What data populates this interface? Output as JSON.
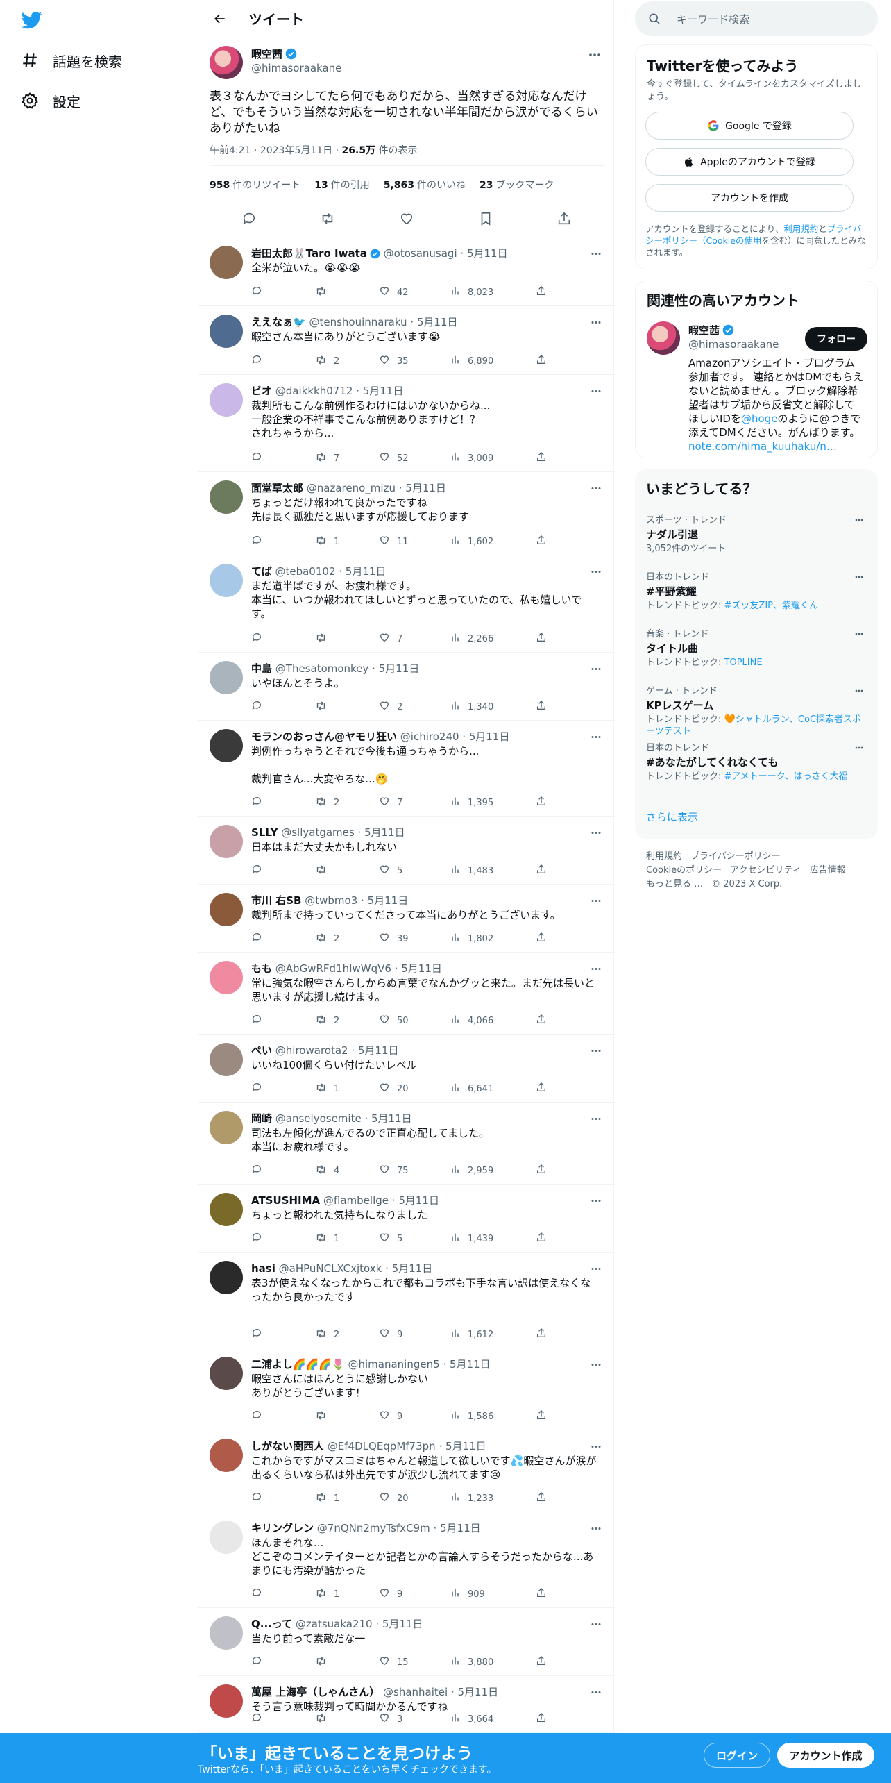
{
  "nav": {
    "explore_label": "話題を検索",
    "settings_label": "設定"
  },
  "header": {
    "title": "ツイート"
  },
  "focal": {
    "name": "暇空茜",
    "handle": "@himasoraakane",
    "text": "表３なんかでヨシしてたら何でもありだから、当然すぎる対応なんだけど、でもそういう当然な対応を一切されない半年間だから涙がでるくらいありがたいね",
    "time": "午前4:21",
    "date": "2023年5月11日",
    "views_count": "26.5万",
    "views_label": "件の表示",
    "retweets_count": "958",
    "retweets_label": "件のリツイート",
    "quotes_count": "13",
    "quotes_label": "件の引用",
    "likes_count": "5,863",
    "likes_label": "件のいいね",
    "bookmarks_count": "23",
    "bookmarks_label": "ブックマーク"
  },
  "replies": [
    {
      "name": "岩田太郎🐰Taro Iwata",
      "handle": "@otosanusagi",
      "date": "5月11日",
      "text": "全米が泣いた。😭😭😭",
      "reply": "",
      "rt": "",
      "likes": "42",
      "views": "8,023",
      "verified": true,
      "color": "#8a6a50"
    },
    {
      "name": "ええなぁ🐦",
      "handle": "@tenshouinnaraku",
      "date": "5月11日",
      "text": "暇空さん本当にありがとうございます😭",
      "reply": "",
      "rt": "2",
      "likes": "35",
      "views": "6,890",
      "verified": false,
      "color": "#4f6b8f"
    },
    {
      "name": "ビオ",
      "handle": "@daikkkh0712",
      "date": "5月11日",
      "text": "裁判所もこんな前例作るわけにはいかないからね...\n一般企業の不祥事でこんな前例ありますけど！？\nされちゃうから...",
      "reply": "",
      "rt": "7",
      "likes": "52",
      "views": "3,009",
      "verified": false,
      "color": "#c9b8e8"
    },
    {
      "name": "面堂草太郎",
      "handle": "@nazareno_mizu",
      "date": "5月11日",
      "text": "ちょっとだけ報われて良かったですね\n先は長く孤独だと思いますが応援しております",
      "reply": "",
      "rt": "1",
      "likes": "11",
      "views": "1,602",
      "verified": false,
      "color": "#6c7a5e"
    },
    {
      "name": "てば",
      "handle": "@teba0102",
      "date": "5月11日",
      "text": "まだ道半ばですが、お疲れ様です。\n本当に、いつか報われてほしいとずっと思っていたので、私も嬉しいです。",
      "reply": "",
      "rt": "",
      "likes": "7",
      "views": "2,266",
      "verified": false,
      "color": "#a8c8e8"
    },
    {
      "name": "中島",
      "handle": "@Thesatomonkey",
      "date": "5月11日",
      "text": "いやほんとそうよ。",
      "reply": "",
      "rt": "",
      "likes": "2",
      "views": "1,340",
      "verified": false,
      "color": "#aab4bc"
    },
    {
      "name": "モランのおっさん@ヤモリ狂い",
      "handle": "@ichiro240",
      "date": "5月11日",
      "text": "判例作っちゃうとそれで今後も通っちゃうから...\n\n裁判官さん...大変やろな...🤭",
      "reply": "",
      "rt": "2",
      "likes": "7",
      "views": "1,395",
      "verified": false,
      "color": "#3a3a3a"
    },
    {
      "name": "SLLY",
      "handle": "@sllyatgames",
      "date": "5月11日",
      "text": "日本はまだ大丈夫かもしれない",
      "reply": "",
      "rt": "",
      "likes": "5",
      "views": "1,483",
      "verified": false,
      "color": "#c8a0a8"
    },
    {
      "name": "市川 右SB",
      "handle": "@twbmo3",
      "date": "5月11日",
      "text": "裁判所まで持っていってくださって本当にありがとうございます。",
      "reply": "",
      "rt": "2",
      "likes": "39",
      "views": "1,802",
      "verified": false,
      "color": "#8a5a3a"
    },
    {
      "name": "もも",
      "handle": "@AbGwRFd1hIwWqV6",
      "date": "5月11日",
      "text": "常に強気な暇空さんらしからぬ言葉でなんかグッと来た。まだ先は長いと思いますが応援し続けます。",
      "reply": "",
      "rt": "2",
      "likes": "50",
      "views": "4,066",
      "verified": false,
      "color": "#f08aa0"
    },
    {
      "name": "ぺい",
      "handle": "@hirowarota2",
      "date": "5月11日",
      "text": "いいね100個くらい付けたいレベル",
      "reply": "",
      "rt": "1",
      "likes": "20",
      "views": "6,641",
      "verified": false,
      "color": "#9a8a80"
    },
    {
      "name": "岡崎",
      "handle": "@anselyosemite",
      "date": "5月11日",
      "text": "司法も左傾化が進んでるので正直心配してました。\n本当にお疲れ様です。",
      "reply": "",
      "rt": "4",
      "likes": "75",
      "views": "2,959",
      "verified": false,
      "color": "#b09a6a"
    },
    {
      "name": "ATSUSHIMA",
      "handle": "@flambellge",
      "date": "5月11日",
      "text": "ちょっと報われた気持ちになりました",
      "reply": "",
      "rt": "1",
      "likes": "5",
      "views": "1,439",
      "verified": false,
      "color": "#7a6a2a"
    },
    {
      "name": "hasi",
      "handle": "@aHPuNCLXCxjtoxk",
      "date": "5月11日",
      "text": "表3が使えなくなったからこれで都もコラボも下手な言い訳は使えなくなったから良かったです",
      "reply": "",
      "rt": "2",
      "likes": "9",
      "views": "1,612",
      "verified": false,
      "color": "#2a2a2a"
    },
    {
      "name": "二浦よし🌈🌈🌈🌷",
      "handle": "@himananingen5",
      "date": "5月11日",
      "text": "暇空さんにはほんとうに感謝しかない\nありがとうございます！",
      "reply": "",
      "rt": "",
      "likes": "9",
      "views": "1,586",
      "verified": false,
      "color": "#5a4a4a"
    },
    {
      "name": "しがない関西人",
      "handle": "@Ef4DLQEqpMf73pn",
      "date": "5月11日",
      "text": "これからですがマスコミはちゃんと報道して欲しいです💦暇空さんが涙が出るくらいなら私は外出先ですが涙少し流れてます😢",
      "reply": "",
      "rt": "1",
      "likes": "20",
      "views": "1,233",
      "verified": false,
      "color": "#b05a4a"
    },
    {
      "name": "キリングレン",
      "handle": "@7nQNn2myTsfxC9m",
      "date": "5月11日",
      "text": "ほんまそれな...\nどこぞのコメンテイターとか記者とかの言論人すらそうだったからな...あまりにも汚染が酷かった",
      "reply": "",
      "rt": "1",
      "likes": "9",
      "views": "909",
      "verified": false,
      "color": "#e8e8e8"
    },
    {
      "name": "Q...って",
      "handle": "@zatsuaka210",
      "date": "5月11日",
      "text": "当たり前って素敵だな一",
      "reply": "",
      "rt": "",
      "likes": "15",
      "views": "3,880",
      "verified": false,
      "color": "#c0c0c8"
    },
    {
      "name": "萬屋 上海亭（しゃんさん）",
      "handle": "@shanhaitei",
      "date": "5月11日",
      "text": "そう言う意味裁判って時間かかるんですね",
      "reply": "",
      "rt": "",
      "likes": "3",
      "views": "3,664",
      "verified": false,
      "color": "#c04a4a"
    }
  ],
  "search": {
    "placeholder": "キーワード検索"
  },
  "signup": {
    "title": "Twitterを使ってみよう",
    "subtitle": "今すぐ登録して、タイムラインをカスタマイズしましょう。",
    "google_label": "Google で登録",
    "apple_label": "Appleのアカウントで登録",
    "create_label": "アカウントを作成",
    "legal_prefix": "アカウントを登録することにより、",
    "legal_terms": "利用規約",
    "legal_and": "と",
    "legal_privacy": "プライバシーポリシー（Cookieの使用",
    "legal_suffix": "を含む）に同意したとみなされます。"
  },
  "related": {
    "title": "関連性の高いアカウント",
    "name": "暇空茜",
    "handle": "@himasoraakane",
    "follow_label": "フォロー",
    "bio": "Amazonアソシエイト・プログラム参加者です。 連絡とかはDMでもらえないと読めません 。ブロック解除希望者はサブ垢から反省文と解除してほしいIDを",
    "bio_link1": "@hoge",
    "bio_mid": "のように@つきで添えてDMください。がんばります。",
    "bio_link2": "note.com/hima_kuuhaku/n…"
  },
  "trends": {
    "title": "いまどうしてる？",
    "items": [
      {
        "context": "スポーツ · トレンド",
        "name": "ナダル引退",
        "extra": "3,052件のツイート",
        "topic_prefix": "",
        "topic_links": ""
      },
      {
        "context": "日本のトレンド",
        "name": "#平野紫耀",
        "extra": "",
        "topic_prefix": "トレンドトピック: ",
        "topic_links": "#ズッ友ZIP、紫耀くん"
      },
      {
        "context": "音楽 · トレンド",
        "name": "タイトル曲",
        "extra": "",
        "topic_prefix": "トレンドトピック: ",
        "topic_links": "TOPLINE"
      },
      {
        "context": "ゲーム · トレンド",
        "name": "KPレスゲーム",
        "extra": "",
        "topic_prefix": "トレンドトピック: 🧡",
        "topic_links": "シャトルラン、CoC探索者スポーツテスト"
      },
      {
        "context": "日本のトレンド",
        "name": "#あなたがしてくれなくても",
        "extra": "",
        "topic_prefix": "トレンドトピック: ",
        "topic_links": "#アメトーーク、はっさく大福"
      }
    ],
    "show_more": "さらに表示"
  },
  "footer": {
    "terms": "利用規約",
    "privacy": "プライバシーポリシー",
    "cookies": "Cookieのポリシー",
    "accessibility": "アクセシビリティ",
    "ads": "広告情報",
    "more": "もっと見る …",
    "copyright": "© 2023 X Corp."
  },
  "bottombar": {
    "title": "「いま」起きていることを見つけよう",
    "subtitle": "Twitterなら、「いま」起きていることをいち早くチェックできます。",
    "login_label": "ログイン",
    "signup_label": "アカウント作成"
  },
  "colors": {
    "accent": "#1d9bf0",
    "text": "#0f1419",
    "muted": "#536471"
  }
}
